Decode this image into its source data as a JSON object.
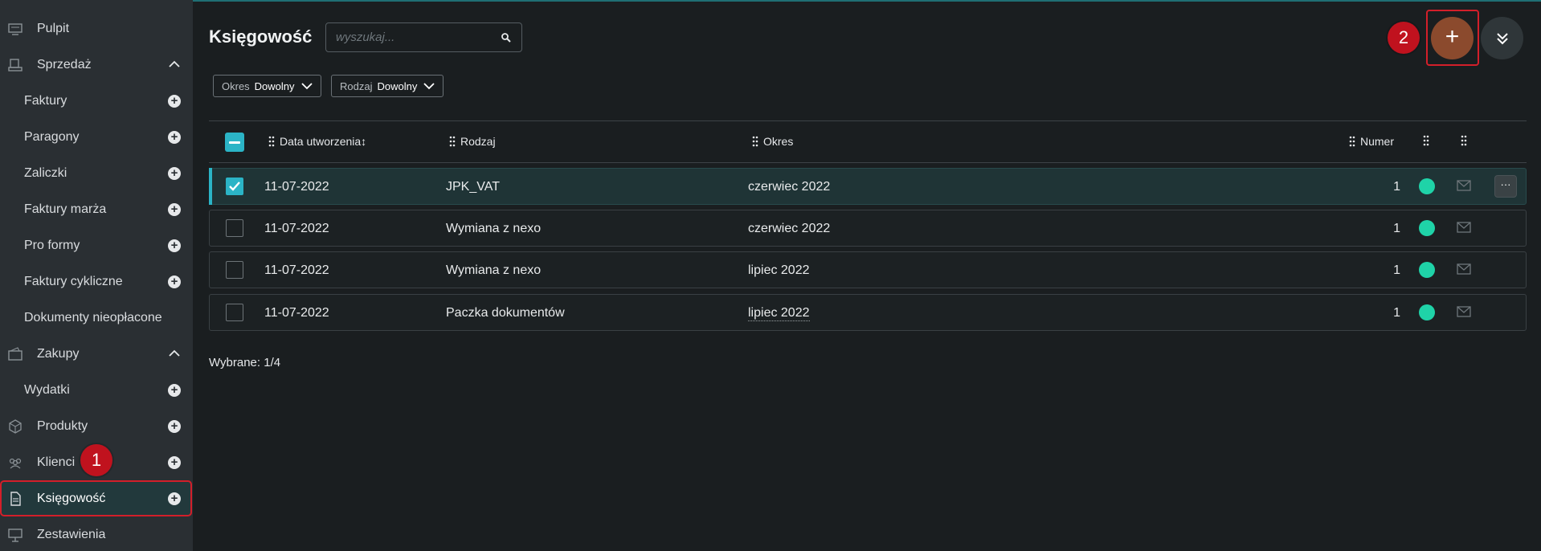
{
  "sidebar": {
    "items": [
      {
        "label": "Pulpit"
      },
      {
        "label": "Sprzedaż"
      },
      {
        "label": "Faktury"
      },
      {
        "label": "Paragony"
      },
      {
        "label": "Zaliczki"
      },
      {
        "label": "Faktury marża"
      },
      {
        "label": "Pro formy"
      },
      {
        "label": "Faktury cykliczne"
      },
      {
        "label": "Dokumenty nieopłacone"
      },
      {
        "label": "Zakupy"
      },
      {
        "label": "Wydatki"
      },
      {
        "label": "Produkty"
      },
      {
        "label": "Klienci"
      },
      {
        "label": "Księgowość"
      },
      {
        "label": "Zestawienia"
      }
    ],
    "plus_glyph": "+"
  },
  "annotations": {
    "badge1": "1",
    "badge2": "2"
  },
  "header": {
    "title": "Księgowość",
    "search_placeholder": "wyszukaj...",
    "add_glyph": "+"
  },
  "filters": [
    {
      "key": "Okres",
      "value": "Dowolny"
    },
    {
      "key": "Rodzaj",
      "value": "Dowolny"
    }
  ],
  "table": {
    "columns": {
      "created": "Data utworzenia↕",
      "type": "Rodzaj",
      "period": "Okres",
      "number": "Numer"
    },
    "rows": [
      {
        "date": "11-07-2022",
        "type": "JPK_VAT",
        "period": "czerwiec 2022",
        "number": "1"
      },
      {
        "date": "11-07-2022",
        "type": "Wymiana z nexo",
        "period": "czerwiec 2022",
        "number": "1"
      },
      {
        "date": "11-07-2022",
        "type": "Wymiana z nexo",
        "period": "lipiec 2022",
        "number": "1"
      },
      {
        "date": "11-07-2022",
        "type": "Paczka dokumentów",
        "period": "lipiec 2022",
        "number": "1"
      }
    ],
    "row_actions_glyph": "···"
  },
  "summary": "Wybrane: 1/4",
  "colors": {
    "accent": "#2bb4c6",
    "status": "#1fd3a8",
    "highlight": "#d31f2a",
    "add": "#8b4a2d"
  }
}
